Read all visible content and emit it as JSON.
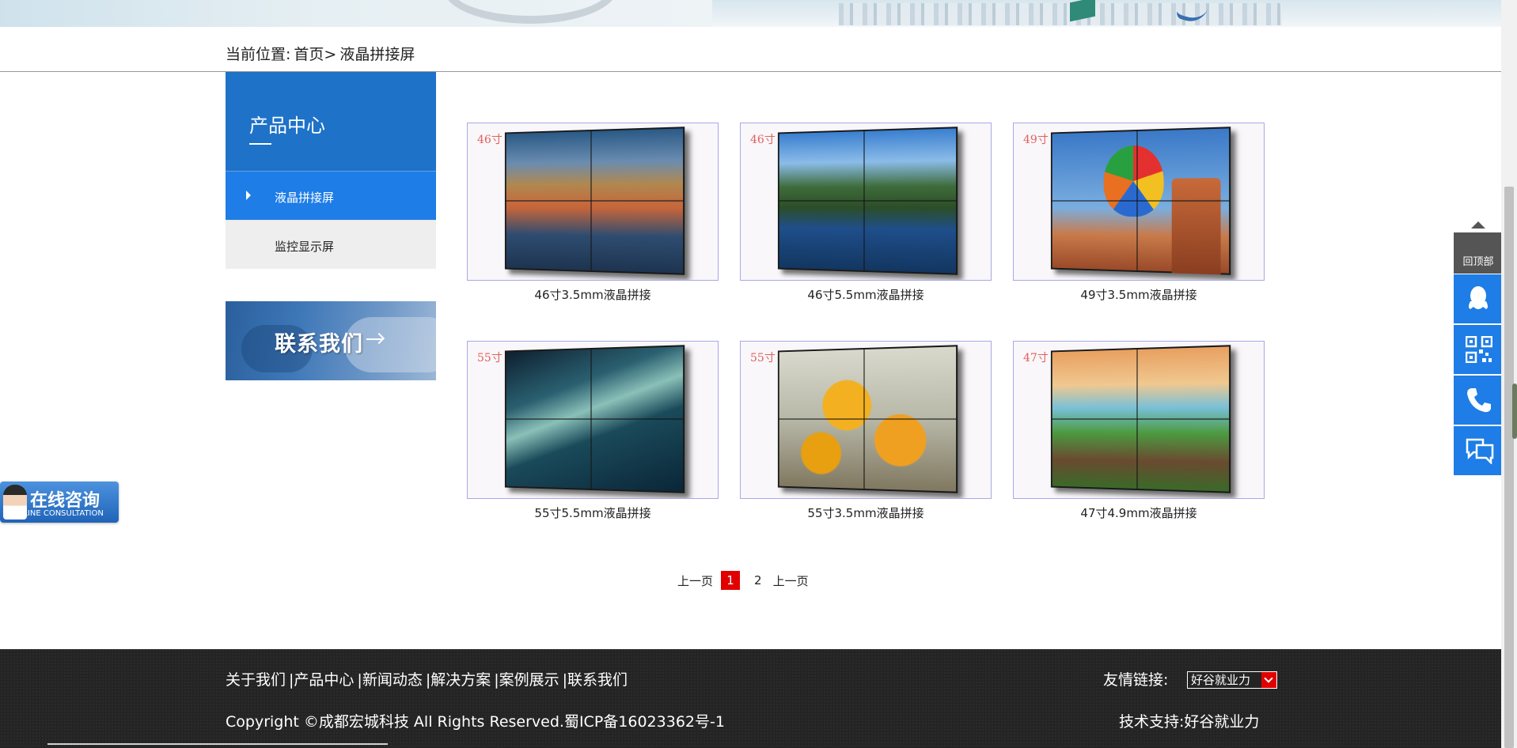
{
  "breadcrumb": {
    "prefix": "当前位置:",
    "home": "首页>",
    "current": "液晶拼接屏"
  },
  "sidebar": {
    "title": "产品中心",
    "items": [
      {
        "label": "液晶拼接屏",
        "active": true
      },
      {
        "label": "监控显示屏",
        "active": false
      }
    ],
    "contact_banner": "联系我们"
  },
  "products": [
    {
      "size_tag": "46寸",
      "name": "46寸3.5mm液晶拼接",
      "image": "venice-canal-video-wall"
    },
    {
      "size_tag": "46寸",
      "name": "46寸5.5mm液晶拼接",
      "image": "mountain-lake-video-wall"
    },
    {
      "size_tag": "49寸",
      "name": "49寸3.5mm液晶拼接",
      "image": "hot-air-balloon-video-wall"
    },
    {
      "size_tag": "55寸",
      "name": "55寸5.5mm液晶拼接",
      "image": "waterfall-video-wall"
    },
    {
      "size_tag": "55寸",
      "name": "55寸3.5mm液晶拼接",
      "image": "yellow-flowers-video-wall"
    },
    {
      "size_tag": "47寸",
      "name": "47寸4.9mm液晶拼接",
      "image": "beach-dock-video-wall"
    }
  ],
  "pagination": {
    "prev": "上一页",
    "pages": [
      "1",
      "2"
    ],
    "current_page": "1",
    "next": "上一页"
  },
  "online_consult": {
    "title": "在线咨询",
    "subtitle": "ONLINE CONSULTATION"
  },
  "right_toolbar": {
    "back_to_top": "回顶部",
    "buttons": [
      "qq-icon",
      "qr-code-icon",
      "phone-icon",
      "chat-icon"
    ]
  },
  "footer": {
    "nav": [
      "关于我们",
      "|产品中心",
      "|新闻动态",
      "|解决方案",
      "|案例展示",
      "|联系我们"
    ],
    "copyright": "Copyright ©成都宏城科技 All Rights Reserved.蜀ICP备16023362号-1",
    "friend_links_label": "友情链接:",
    "friend_links_selected": "好谷就业力",
    "tech_support": "技术支持:好谷就业力"
  },
  "colors": {
    "primary_blue": "#1e72c8",
    "active_item_blue": "#1e7de6",
    "page_current_red": "#e00000",
    "footer_bg": "#242424"
  }
}
